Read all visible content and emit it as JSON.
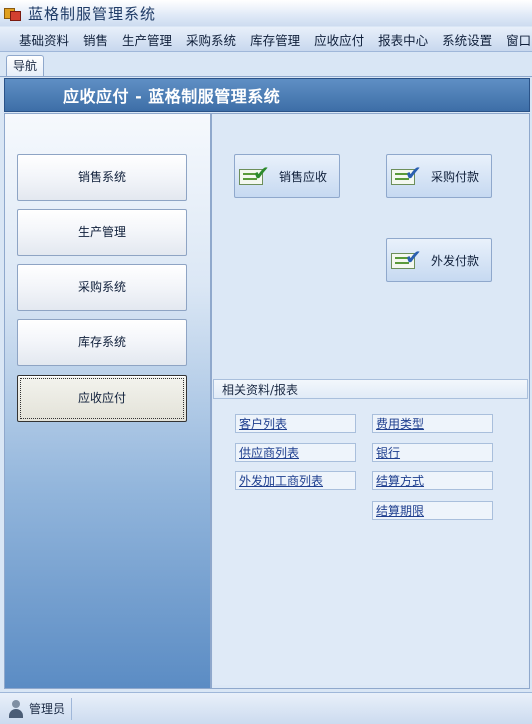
{
  "window": {
    "title": "蓝格制服管理系统"
  },
  "menu": [
    "基础资料",
    "销售",
    "生产管理",
    "采购系统",
    "库存管理",
    "应收应付",
    "报表中心",
    "系统设置",
    "窗口"
  ],
  "tabs": [
    {
      "label": "导航"
    }
  ],
  "header": {
    "title": "应收应付 - 蓝格制服管理系统"
  },
  "nav": {
    "items": [
      "销售系统",
      "生产管理",
      "采购系统",
      "库存系统",
      "应收应付"
    ],
    "active": "应收应付"
  },
  "actions": [
    {
      "label": "销售应收",
      "icon": "green-check-document-icon",
      "color": "#2c8a2c"
    },
    {
      "label": "采购付款",
      "icon": "blue-check-document-icon",
      "color": "#2a5fb0"
    },
    {
      "label": "外发付款",
      "icon": "blue-check-document-icon",
      "color": "#2a5fb0"
    }
  ],
  "related": {
    "title": "相关资料/报表",
    "left_links": [
      "客户列表",
      "供应商列表",
      "外发加工商列表"
    ],
    "right_links": [
      "费用类型",
      "银行",
      "结算方式",
      "结算期限"
    ]
  },
  "status": {
    "user": "管理员"
  }
}
